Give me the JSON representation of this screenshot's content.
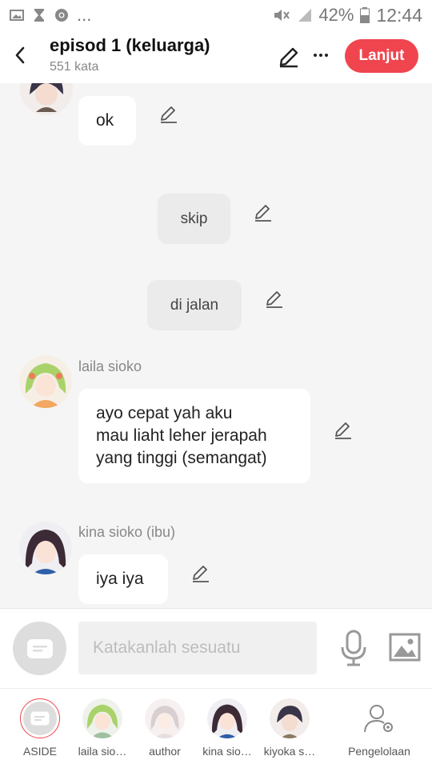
{
  "status_bar": {
    "left_icons": [
      "image-icon",
      "hourglass-icon",
      "chrome-icon"
    ],
    "ellipsis": "...",
    "battery": "42%",
    "time": "12:44"
  },
  "header": {
    "title": "episod 1 (keluarga)",
    "word_count": "551 kata",
    "next_label": "Lanjut"
  },
  "messages": [
    {
      "type": "bubble",
      "text": "ok"
    },
    {
      "type": "narration",
      "text": "skip"
    },
    {
      "type": "narration",
      "text": "di jalan"
    },
    {
      "type": "bubble",
      "name": "laila sioko",
      "lines": [
        "ayo cepat yah aku",
        "mau liaht leher jerapah",
        "yang tinggi (semangat)"
      ]
    },
    {
      "type": "bubble",
      "name": "kina sioko (ibu)",
      "text": "iya iya"
    }
  ],
  "input": {
    "placeholder": "Katakanlah sesuatu"
  },
  "tabs": [
    {
      "label": "ASIDE"
    },
    {
      "label": "laila sio…"
    },
    {
      "label": "author"
    },
    {
      "label": "kina sio…"
    },
    {
      "label": "kiyoka s…"
    },
    {
      "label": "Pengelolaan"
    }
  ],
  "colors": {
    "accent": "#f0454e",
    "background": "#f5f5f5"
  }
}
